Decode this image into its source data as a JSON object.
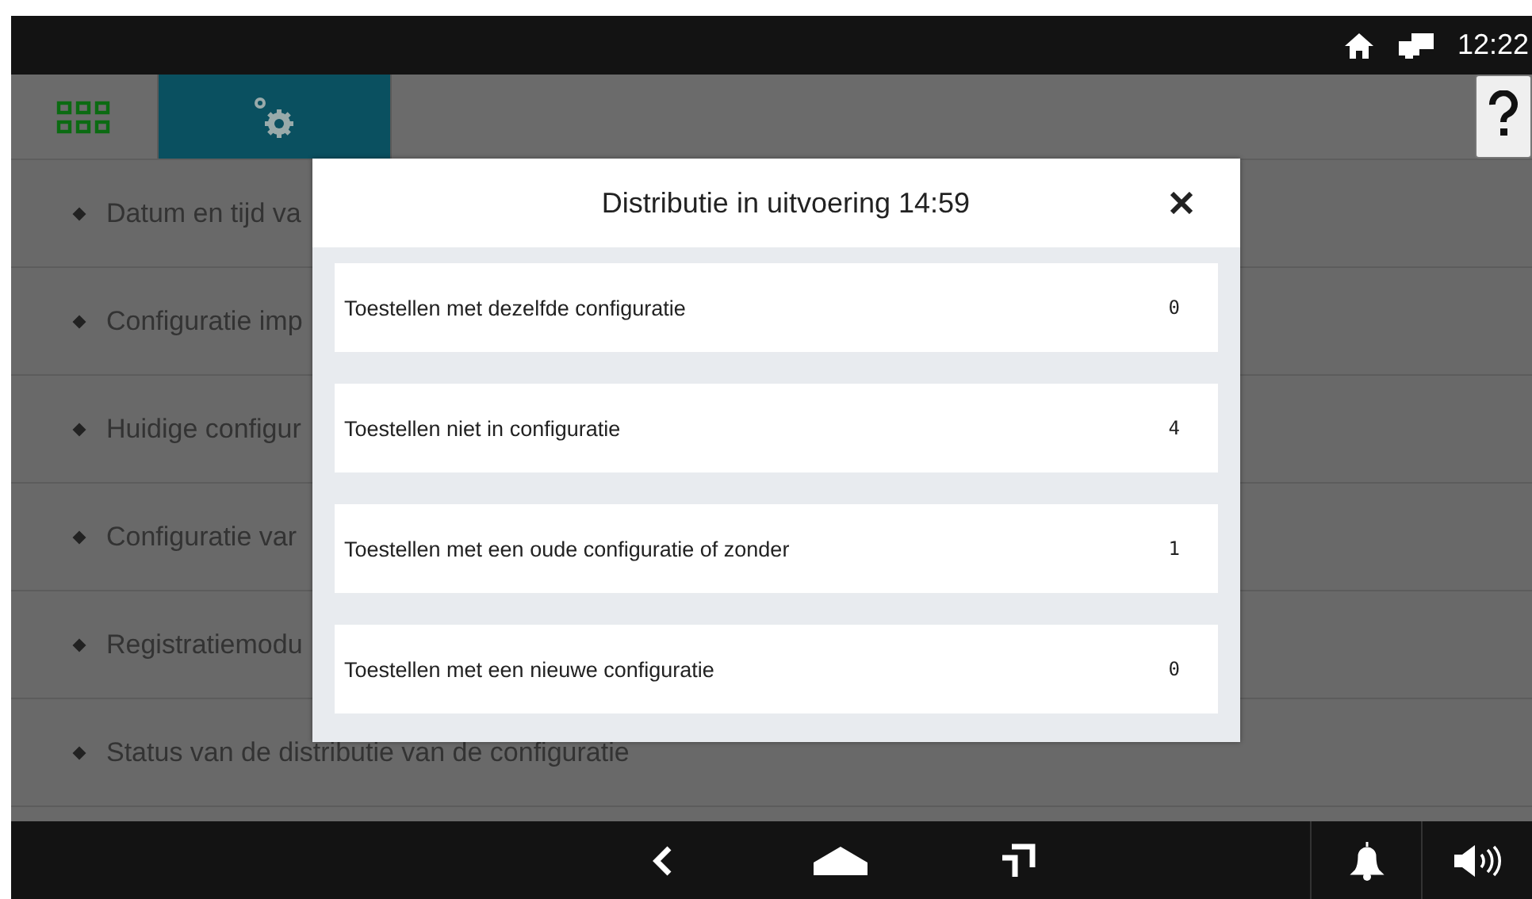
{
  "status_bar": {
    "time": "12:22"
  },
  "top_bar": {
    "tabs": [
      {
        "kind": "apps",
        "selected": false
      },
      {
        "kind": "settings",
        "selected": true
      }
    ]
  },
  "menu": {
    "items": [
      "Datum en tijd va",
      "Configuratie imp",
      "Huidige configur",
      "Configuratie var",
      "Registratiemodu",
      "Status van de distributie van de configuratie"
    ]
  },
  "dialog": {
    "title": "Distributie in uitvoering 14:59",
    "rows": [
      {
        "label": "Toestellen met dezelfde configuratie",
        "value": "0"
      },
      {
        "label": "Toestellen niet in configuratie",
        "value": "4"
      },
      {
        "label": "Toestellen met een oude configuratie of zonder",
        "value": "1"
      },
      {
        "label": "Toestellen met een nieuwe configuratie",
        "value": "0"
      }
    ]
  }
}
